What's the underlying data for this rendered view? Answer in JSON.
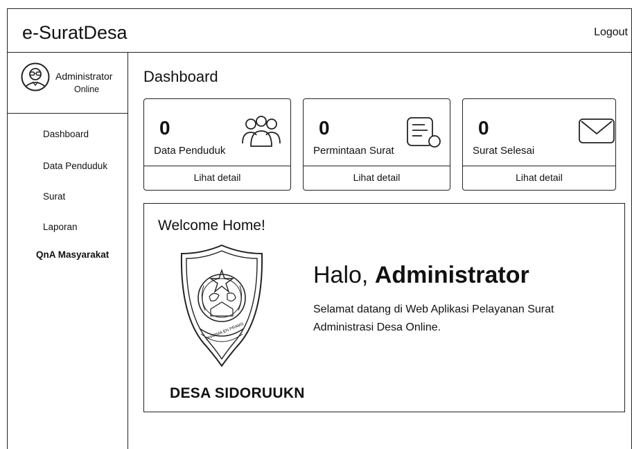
{
  "app": {
    "title": "e-SuratDesa",
    "logout_label": "Logout"
  },
  "user": {
    "name": "Administrator",
    "status": "Online"
  },
  "sidebar": {
    "items": [
      {
        "label": "Dashboard"
      },
      {
        "label": "Data Penduduk"
      },
      {
        "label": "Surat"
      },
      {
        "label": "Laporan"
      },
      {
        "label": "QnA Masyarakat"
      }
    ]
  },
  "main": {
    "title": "Dashboard"
  },
  "cards": [
    {
      "value": "0",
      "label": "Data Penduduk",
      "link": "Lihat detail",
      "icon": "users-icon"
    },
    {
      "value": "0",
      "label": "Permintaan Surat",
      "link": "Lihat detail",
      "icon": "document-request-icon"
    },
    {
      "value": "0",
      "label": "Surat Selesai",
      "link": "Lihat detail",
      "icon": "envelope-icon"
    }
  ],
  "welcome": {
    "title": "Welcome Home!",
    "greeting_prefix": "Halo,",
    "greeting_name": "Administrator",
    "message": "Selamat datang di Web Aplikasi Pelayanan Surat Administrasi Desa Online.",
    "village_name": "DESA SIDORUUKN",
    "emblem_motto": "DHARMA EN PRAMS"
  }
}
